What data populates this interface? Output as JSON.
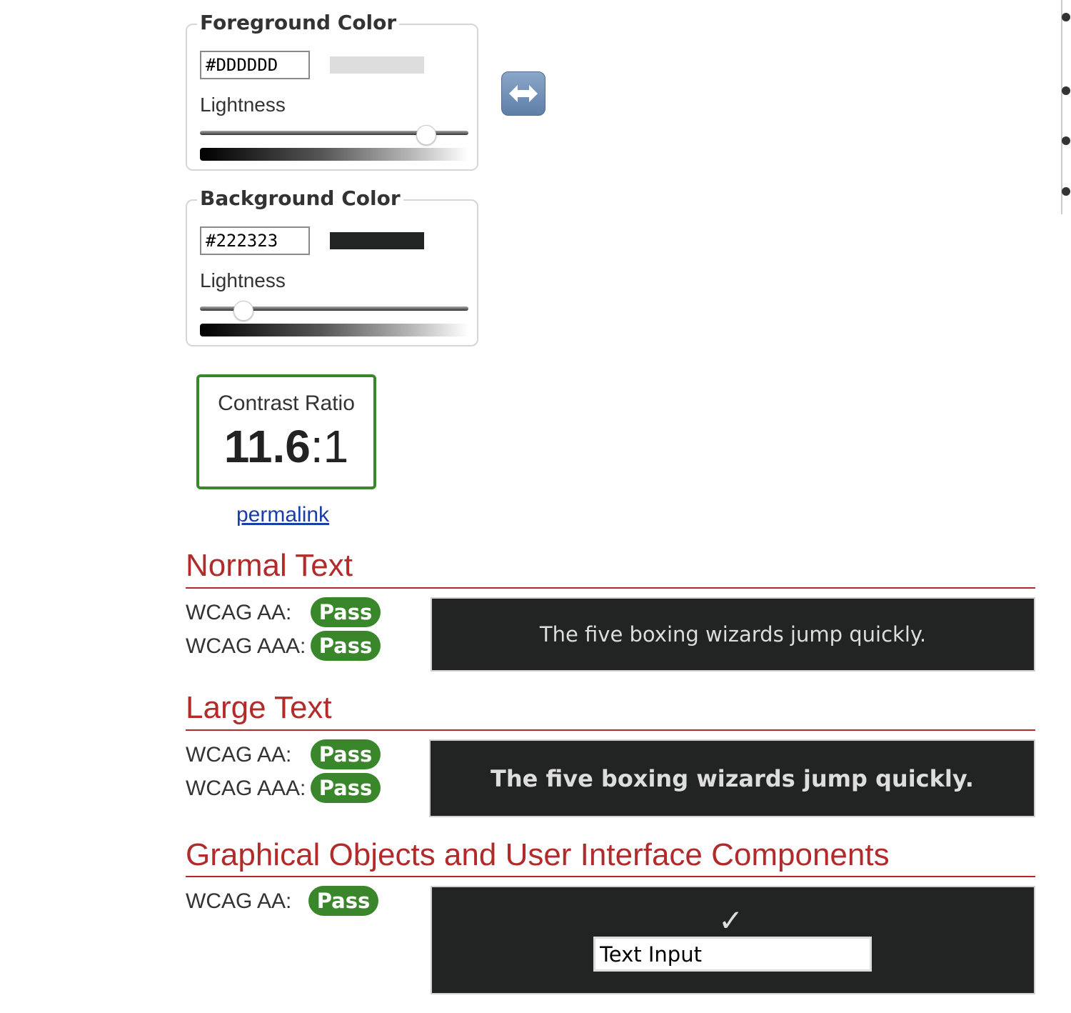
{
  "foreground": {
    "title": "Foreground Color",
    "hex_value": "#DDDDDD",
    "swatch_color": "#dddddd",
    "lightness_label": "Lightness",
    "lightness_fraction": 0.84
  },
  "background": {
    "title": "Background Color",
    "hex_value": "#222323",
    "swatch_color": "#222323",
    "lightness_label": "Lightness",
    "lightness_fraction": 0.16
  },
  "swap_button": {
    "icon": "left-right-arrow-icon"
  },
  "contrast": {
    "label": "Contrast Ratio",
    "ratio_main": "11.6",
    "ratio_suffix": ":1",
    "accent_color": "#3a862b"
  },
  "permalink": {
    "label": "permalink"
  },
  "normal_text": {
    "title": "Normal Text",
    "aa_label": "WCAG AA:",
    "aa_result": "Pass",
    "aaa_label": "WCAG AAA:",
    "aaa_result": "Pass",
    "sample": "The five boxing wizards jump quickly."
  },
  "large_text": {
    "title": "Large Text",
    "aa_label": "WCAG AA:",
    "aa_result": "Pass",
    "aaa_label": "WCAG AAA:",
    "aaa_result": "Pass",
    "sample": "The five boxing wizards jump quickly."
  },
  "graphical": {
    "title": "Graphical Objects and User Interface Components",
    "aa_label": "WCAG AA:",
    "aa_result": "Pass",
    "checkmark": "✓",
    "input_value": "Text Input"
  },
  "colors": {
    "heading_red": "#b22b2b",
    "pass_green": "#3a862b",
    "link_blue": "#1a3da8"
  }
}
